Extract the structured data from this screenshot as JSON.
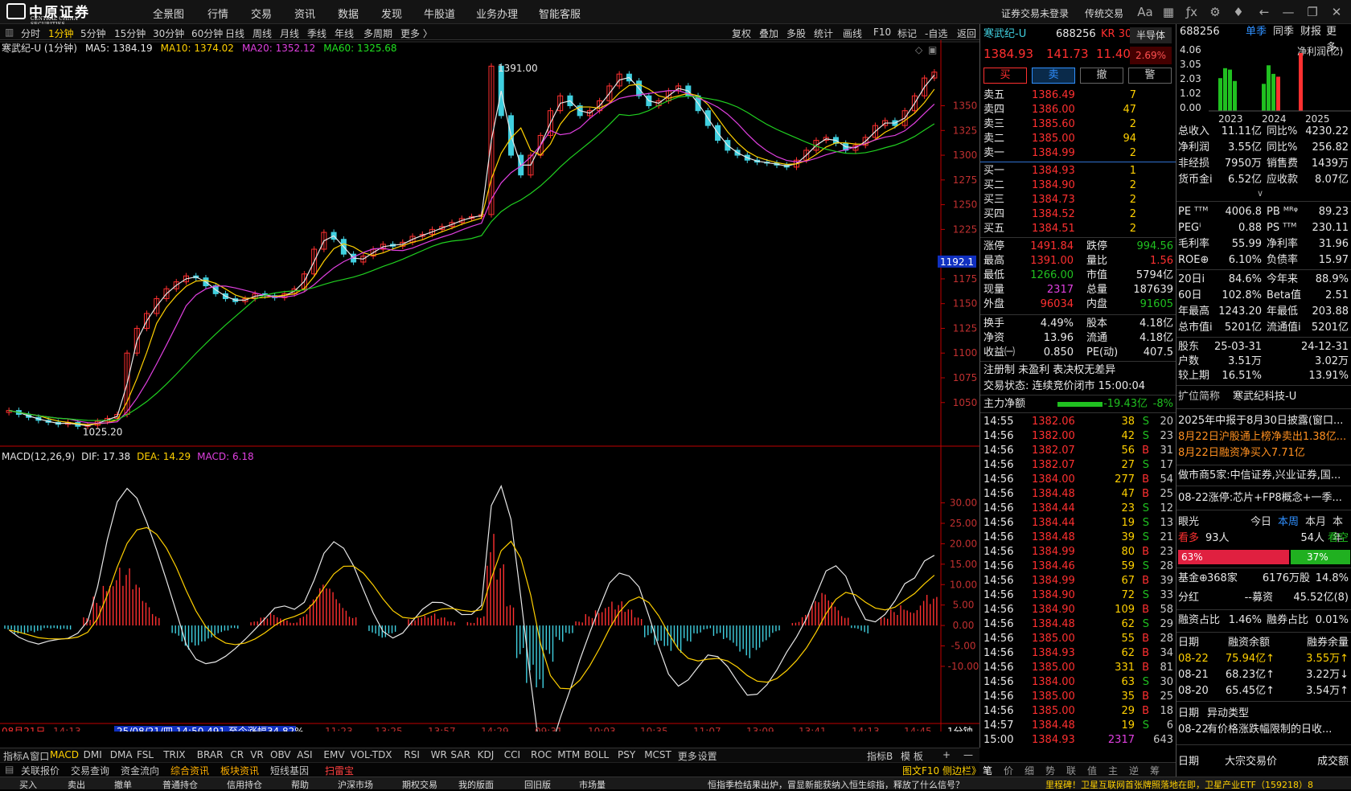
{
  "menu": {
    "items": [
      "全景图",
      "行情",
      "交易",
      "资讯",
      "数据",
      "发现",
      "牛股道",
      "业务办理",
      "智能客服"
    ],
    "login": "证券交易未登录",
    "trad": "传统交易",
    "logo_cn": "中原证券",
    "logo_en": "CENTRAL CHINA SECURITIES"
  },
  "timeframes": [
    "分时",
    "1分钟",
    "5分钟",
    "15分钟",
    "30分钟",
    "60分钟",
    "日线",
    "周线",
    "月线",
    "季线",
    "年线",
    "多周期",
    "更多 〉"
  ],
  "chart_tools": [
    "复权",
    "叠加",
    "多股",
    "统计",
    "画线",
    "F10",
    "标记",
    "-自选",
    "返回"
  ],
  "main_legend": {
    "title": "寒武纪-U (1分钟)",
    "ma5": "MA5: 1384.19",
    "ma10": "MA10: 1374.02",
    "ma20": "MA20: 1352.12",
    "ma60": "MA60: 1325.68"
  },
  "macd_legend": {
    "title": "MACD(12,26,9)",
    "dif": "DIF: 17.38",
    "dea": "DEA: 14.29",
    "macd": "MACD: 6.18"
  },
  "chart_data": [
    {
      "type": "candlestick",
      "title": "寒武纪-U (1分钟)",
      "y_ticks": [
        1050,
        1075,
        1100,
        1125,
        1150,
        1175,
        1225,
        1250,
        1275,
        1300,
        1325,
        1350
      ],
      "ylim": [
        1010,
        1400
      ],
      "current_price_label": "1192.1",
      "annotations": [
        "1391.00",
        "1025.20"
      ],
      "x_ticks": [
        "14:13",
        "11:23",
        "13:25",
        "13:57",
        "14:29",
        "09:31",
        "10:03",
        "10:35",
        "11:07",
        "13:09",
        "13:41",
        "14:13",
        "14:45"
      ],
      "date_label": "08月21日",
      "highlight": "25/08/21/四 14:50 491 至今涨幅34.82%",
      "period": "1分钟",
      "close": [
        1042,
        1038,
        1035,
        1032,
        1030,
        1028,
        1030,
        1026,
        1027,
        1031,
        1034,
        1038,
        1100,
        1125,
        1140,
        1155,
        1165,
        1172,
        1178,
        1176,
        1168,
        1160,
        1155,
        1152,
        1155,
        1160,
        1158,
        1156,
        1160,
        1165,
        1180,
        1205,
        1222,
        1215,
        1200,
        1192,
        1198,
        1205,
        1210,
        1208,
        1212,
        1218,
        1220,
        1225,
        1228,
        1232,
        1236,
        1238,
        1240,
        1390,
        1340,
        1300,
        1280,
        1300,
        1320,
        1345,
        1360,
        1350,
        1340,
        1345,
        1355,
        1370,
        1382,
        1375,
        1360,
        1350,
        1355,
        1365,
        1370,
        1360,
        1345,
        1330,
        1315,
        1305,
        1300,
        1295,
        1293,
        1292,
        1290,
        1288,
        1295,
        1305,
        1315,
        1318,
        1312,
        1305,
        1310,
        1318,
        1330,
        1335,
        1330,
        1345,
        1360,
        1378,
        1384
      ]
    },
    {
      "type": "macd",
      "title": "MACD(12,26,9)",
      "y_ticks": [
        30,
        25,
        20,
        15,
        10,
        5,
        0,
        -5,
        -10
      ],
      "ylim": [
        -23,
        37
      ],
      "dif": 17.38,
      "dea": 14.29,
      "macd": 6.18,
      "hist": [
        -1,
        -2,
        -2,
        -2,
        -1,
        -1,
        -1,
        0,
        2,
        8,
        14,
        16,
        14,
        10,
        6,
        3,
        0,
        -3,
        -6,
        -5,
        -4,
        -3,
        -2,
        -1,
        0,
        1,
        2,
        3,
        2,
        1,
        3,
        7,
        10,
        9,
        6,
        3,
        0,
        -2,
        -3,
        -2,
        0,
        2,
        3,
        3,
        2,
        1,
        0,
        1,
        3,
        24,
        15,
        5,
        -8,
        -16,
        -22,
        -10,
        -4,
        -2,
        1,
        3,
        5,
        7,
        6,
        4,
        2,
        -3,
        -6,
        -8,
        -7,
        -4,
        -2,
        -1,
        -3,
        -5,
        -7,
        -8,
        -6,
        -4,
        -2,
        0,
        1,
        3,
        6,
        8,
        6,
        3,
        -1,
        -2,
        0,
        2,
        4,
        6,
        5,
        8,
        7
      ]
    }
  ],
  "bottom_tabs": [
    "指标A",
    "窗口",
    "MACD",
    "DMI",
    "DMA",
    "FSL",
    "TRIX",
    "BRAR",
    "CR",
    "VR",
    "OBV",
    "ASI",
    "EMV",
    "VOL-TDX",
    "RSI",
    "WR",
    "SAR",
    "KDJ",
    "CCI",
    "ROC",
    "MTM",
    "BOLL",
    "PSY",
    "MCST",
    "更多",
    "设置"
  ],
  "bottom_right_tabs": [
    "指标B",
    "模 板",
    "+",
    "—"
  ],
  "sub_tabs": [
    "关联报价",
    "交易查询",
    "资金流向",
    "综合资讯",
    "板块资讯",
    "短线基因",
    "扫雷宝"
  ],
  "quote": {
    "name": "寒武纪-U",
    "code": "688256",
    "tag": "KR 300",
    "sector": "半导体",
    "price": "1384.93",
    "change": "141.73",
    "pct": "11.40%",
    "pct2": "2.69%",
    "buttons": [
      "买",
      "卖",
      "撤",
      "警"
    ],
    "asks": [
      [
        "卖五",
        "1386.49",
        "7"
      ],
      [
        "卖四",
        "1386.00",
        "47"
      ],
      [
        "卖三",
        "1385.60",
        "2"
      ],
      [
        "卖二",
        "1385.00",
        "94"
      ],
      [
        "卖一",
        "1384.99",
        "2"
      ]
    ],
    "bids": [
      [
        "买一",
        "1384.93",
        "1"
      ],
      [
        "买二",
        "1384.90",
        "2"
      ],
      [
        "买三",
        "1384.73",
        "2"
      ],
      [
        "买四",
        "1384.52",
        "2"
      ],
      [
        "买五",
        "1384.51",
        "2"
      ]
    ],
    "stats": [
      [
        "涨停",
        "1491.84",
        "跌停",
        "994.56"
      ],
      [
        "最高",
        "1391.00",
        "量比",
        "1.56"
      ],
      [
        "最低",
        "1266.00",
        "市值",
        "5794亿"
      ],
      [
        "现量",
        "2317",
        "总量",
        "187639"
      ],
      [
        "外盘",
        "96034",
        "内盘",
        "91605"
      ]
    ],
    "stats2": [
      [
        "换手",
        "4.49%",
        "股本",
        "4.18亿"
      ],
      [
        "净资",
        "13.96",
        "流通",
        "4.18亿"
      ],
      [
        "收益㈠",
        "0.850",
        "PE(动)",
        "407.5"
      ]
    ],
    "note": "注册制 未盈利 表决权无差异",
    "status": "交易状态: 连续竞价闭市 15:00:04",
    "main_flow_label": "主力净额",
    "main_flow": "-19.43亿",
    "main_flow_pct": "-8%",
    "ticks": [
      [
        "14:55",
        "1382.06",
        "38",
        "S",
        "20"
      ],
      [
        "14:56",
        "1382.00",
        "42",
        "S",
        "23"
      ],
      [
        "14:56",
        "1382.07",
        "56",
        "B",
        "31"
      ],
      [
        "14:56",
        "1382.07",
        "27",
        "S",
        "17"
      ],
      [
        "14:56",
        "1384.00",
        "277",
        "B",
        "54"
      ],
      [
        "14:56",
        "1384.48",
        "47",
        "B",
        "25"
      ],
      [
        "14:56",
        "1384.44",
        "23",
        "S",
        "12"
      ],
      [
        "14:56",
        "1384.44",
        "19",
        "S",
        "13"
      ],
      [
        "14:56",
        "1384.48",
        "39",
        "S",
        "21"
      ],
      [
        "14:56",
        "1384.99",
        "80",
        "B",
        "23"
      ],
      [
        "14:56",
        "1384.46",
        "59",
        "S",
        "28"
      ],
      [
        "14:56",
        "1384.99",
        "67",
        "B",
        "39"
      ],
      [
        "14:56",
        "1384.90",
        "72",
        "S",
        "33"
      ],
      [
        "14:56",
        "1384.90",
        "109",
        "B",
        "58"
      ],
      [
        "14:56",
        "1384.48",
        "62",
        "S",
        "29"
      ],
      [
        "14:56",
        "1385.00",
        "55",
        "B",
        "28"
      ],
      [
        "14:56",
        "1384.93",
        "62",
        "B",
        "34"
      ],
      [
        "14:56",
        "1385.00",
        "331",
        "B",
        "81"
      ],
      [
        "14:56",
        "1384.00",
        "63",
        "S",
        "30"
      ],
      [
        "14:56",
        "1385.00",
        "35",
        "B",
        "25"
      ],
      [
        "14:56",
        "1385.00",
        "29",
        "B",
        "18"
      ],
      [
        "14:57",
        "1384.48",
        "19",
        "S",
        "6"
      ],
      [
        "15:00",
        "1384.93",
        "2317",
        "",
        "643"
      ]
    ]
  },
  "finance": {
    "code": "688256",
    "tabs": [
      "单季",
      "同季",
      "财报",
      "更多.."
    ],
    "chart_label": "净利润(亿)",
    "y_ticks": [
      "4.06",
      "3.05",
      "2.03",
      "1.02",
      "0.00"
    ],
    "years": [
      "2023",
      "2024",
      "2025"
    ],
    "bars": [
      2.3,
      3.0,
      2.9,
      2.1,
      0.4,
      0.5,
      0.5,
      1.0,
      2.0,
      3.2,
      2.6,
      2.4,
      2.9,
      4.06
    ],
    "rows1": [
      [
        "总收入",
        "11.11亿",
        "同比%",
        "4230.22"
      ],
      [
        "净利润",
        "3.55亿",
        "同比%",
        "256.82"
      ],
      [
        "非经损",
        "7950万",
        "销售费",
        "1439万"
      ],
      [
        "货币金i",
        "6.52亿",
        "应收款",
        "8.07亿"
      ]
    ],
    "rows2": [
      [
        "PE ᵀᵀᴹ",
        "4006.8",
        "PB ᴹᴿᵠ",
        "89.23"
      ],
      [
        "PEGⁱ",
        "0.88",
        "PS ᵀᵀᴹ",
        "230.11"
      ],
      [
        "毛利率",
        "55.99",
        "净利率",
        "31.96"
      ],
      [
        "ROE⊕",
        "6.10%",
        "负债率",
        "15.97"
      ]
    ],
    "rows3": [
      [
        "20日i",
        "84.6%",
        "今年来",
        "88.9%"
      ],
      [
        "60日",
        "102.8%",
        "Beta值",
        "2.51"
      ],
      [
        "年最高",
        "1243.20",
        "年最低",
        "203.88"
      ],
      [
        "总市值i",
        "5201亿",
        "流通值i",
        "5201亿"
      ]
    ],
    "rows4": [
      [
        "股东",
        "25-03-31",
        "",
        "24-12-31"
      ],
      [
        "户数",
        "3.51万",
        "",
        "3.02万"
      ],
      [
        "较上期",
        "16.51%",
        "",
        "13.91%"
      ]
    ],
    "short_name_label": "扩位简称",
    "short_name": "寒武纪科技-U",
    "news": [
      "2025年中报于8月30日披露(窗口...",
      "8月22日沪股通上榜净卖出1.38亿...",
      "8月22日融资净买入7.71亿"
    ],
    "market_makers": "做市商5家:中信证券,兴业证券,国...",
    "limit_up": "08-22涨停:芯片+FP8概念+一季...",
    "eyes": {
      "label": "眼光",
      "tabs": [
        "今日",
        "本周",
        "本月",
        "本年"
      ],
      "bull_label": "看多",
      "bull": "93人",
      "bear": "54人",
      "bear_label": "看空",
      "bull_pct": "63%",
      "bear_pct": "37%"
    },
    "fund": [
      "基金⊕",
      "368家",
      "6176万股",
      "14.8%"
    ],
    "dividend": [
      "分红",
      "--募资",
      "45.52亿(8)"
    ],
    "margin": [
      "融资占比",
      "1.46%",
      "融券占比",
      "0.01%"
    ],
    "margin_head": [
      "日期",
      "融资余额",
      "融券余量"
    ],
    "margin_rows": [
      [
        "08-22",
        "75.94亿↑",
        "3.55万↑"
      ],
      [
        "08-21",
        "68.23亿↑",
        "3.22万↓"
      ],
      [
        "08-20",
        "65.45亿↑",
        "3.54万↑"
      ]
    ],
    "abn_head": [
      "日期",
      "异动类型"
    ],
    "abn_rows": [
      [
        "08-22",
        "有价格涨跌幅限制的日收..."
      ]
    ],
    "block_head": [
      "日期",
      "大宗交易价",
      "成交额"
    ]
  },
  "quote_bottom_tabs": [
    "笔",
    "价",
    "细",
    "势",
    "联",
    "值",
    "主",
    "逆",
    "筹"
  ],
  "chart_bottom": "图文F10  侧边栏》",
  "toolbar": [
    "买入",
    "卖出",
    "撤单",
    "普通持仓",
    "信用持仓",
    "帮助",
    "沪深市场",
    "期权交易",
    "我的版面",
    "回旧版",
    "市场量"
  ],
  "ticker": "恒指季检结果出炉，冒显新能获纳入恒生综指，释放了什么信号？",
  "ticker2": "里程碑！卫星互联网首张牌照落地在即，卫星产业ETF（159218）8"
}
